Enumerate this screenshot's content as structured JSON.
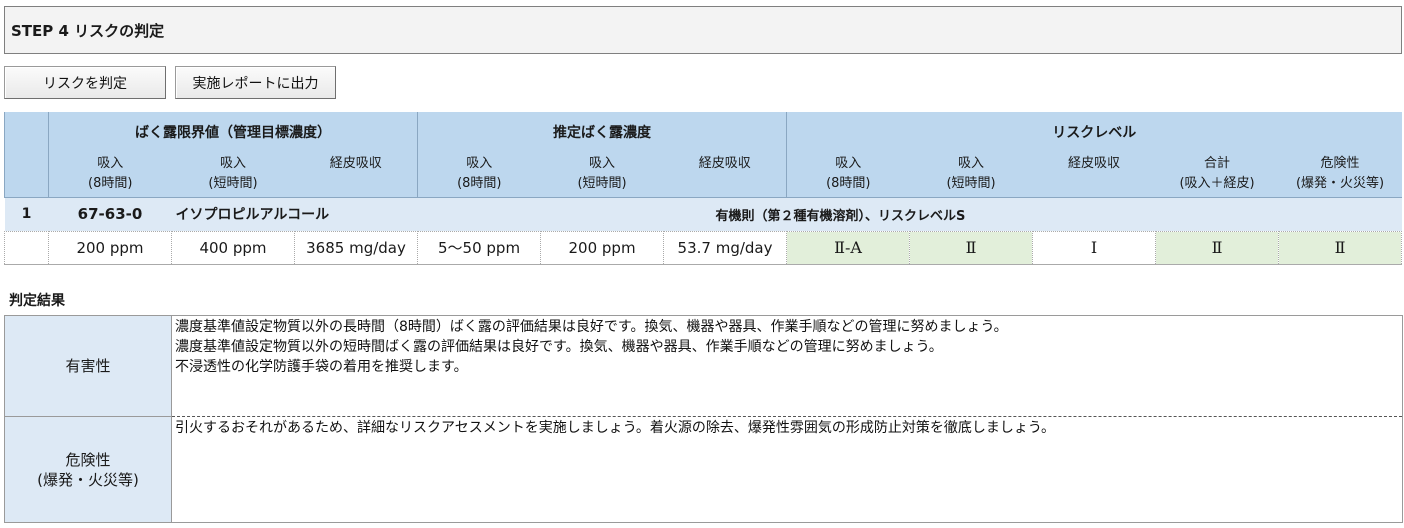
{
  "step": {
    "title": "STEP 4 リスクの判定"
  },
  "buttons": {
    "judge": "リスクを判定",
    "export": "実施レポートに出力"
  },
  "table": {
    "groups": {
      "limit": "ばく露限界値（管理目標濃度）",
      "estimate": "推定ばく露濃度",
      "risk": "リスクレベル"
    },
    "subheaders": {
      "inhale": "吸入",
      "long_note": "(8時間)",
      "short_note": "(短時間)",
      "dermal": "経皮吸収",
      "total": "合計",
      "total_note": "(吸入＋経皮)",
      "hazard": "危険性",
      "hazard_note": "(爆発・火災等)"
    },
    "row": {
      "index": "1",
      "cas": "67-63-0",
      "name": "イソプロピルアルコール",
      "law": "有機則（第２種有機溶剤）、リスクレベルS",
      "limit_long": "200 ppm",
      "limit_short": "400 ppm",
      "limit_dermal": "3685 mg/day",
      "est_long": "5～50 ppm",
      "est_short": "200 ppm",
      "est_dermal": "53.7 mg/day",
      "risk_long": "Ⅱ-A",
      "risk_short": "Ⅱ",
      "risk_dermal": "Ⅰ",
      "risk_total": "Ⅱ",
      "risk_hazard": "Ⅱ"
    }
  },
  "result": {
    "title": "判定結果",
    "harm_label": "有害性",
    "harm_lines": [
      "濃度基準値設定物質以外の長時間（8時間）ばく露の評価結果は良好です。換気、機器や器具、作業手順などの管理に努めましょう。",
      "濃度基準値設定物質以外の短時間ばく露の評価結果は良好です。換気、機器や器具、作業手順などの管理に努めましょう。",
      "不浸透性の化学防護手袋の着用を推奨します。"
    ],
    "hazard_label": "危険性",
    "hazard_label_note": "(爆発・火災等)",
    "hazard_lines": [
      "引火するおそれがあるため、詳細なリスクアセスメントを実施しましょう。着火源の除去、爆発性雰囲気の形成防止対策を徹底しましょう。"
    ]
  },
  "colors": {
    "header_blue": "#bdd7ee",
    "row_blue": "#dde9f5",
    "risk_green": "#e2efda"
  }
}
